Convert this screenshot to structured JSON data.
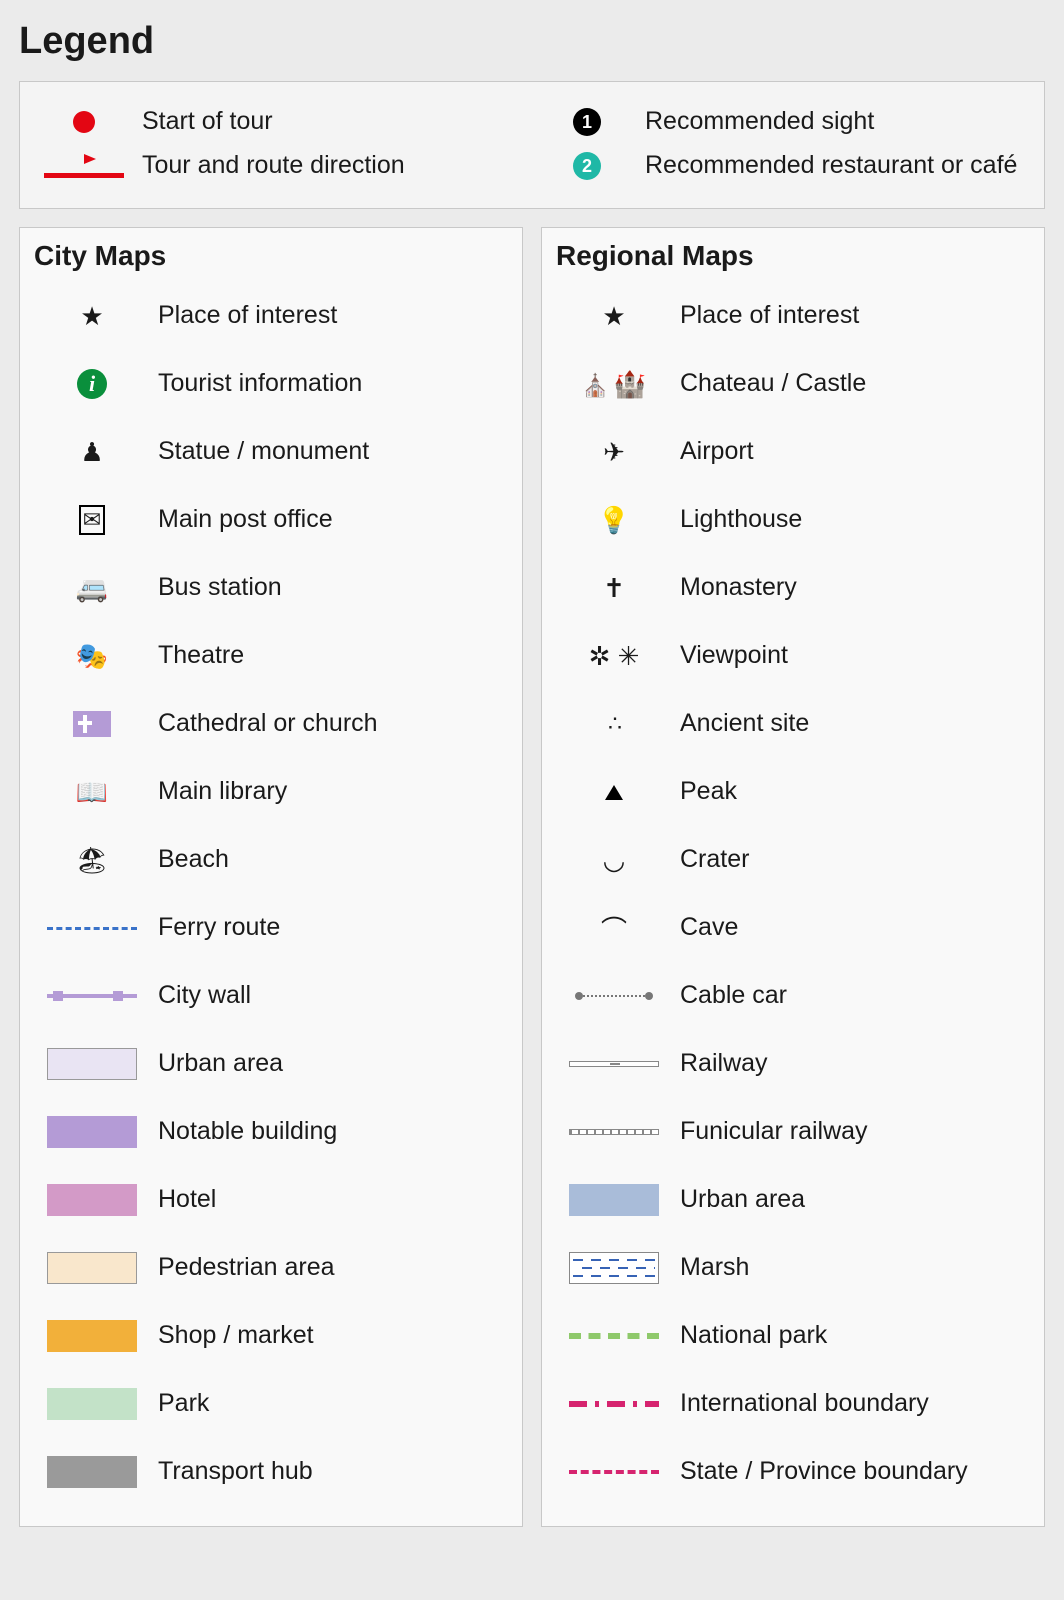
{
  "heading": "Legend",
  "top": {
    "start_of_tour": "Start of tour",
    "tour_route": "Tour and route direction",
    "rec_sight": "Recommended sight",
    "rec_restaurant": "Recommended restaurant or café",
    "num1": "1",
    "num2": "2"
  },
  "city": {
    "title": "City Maps",
    "items": [
      {
        "icon": "star",
        "label": "Place of interest"
      },
      {
        "icon": "info",
        "label": "Tourist information"
      },
      {
        "icon": "statue",
        "label": "Statue / monument"
      },
      {
        "icon": "post",
        "label": "Main post office"
      },
      {
        "icon": "bus",
        "label": "Bus station"
      },
      {
        "icon": "theatre",
        "label": "Theatre"
      },
      {
        "icon": "cathedral",
        "label": "Cathedral or church"
      },
      {
        "icon": "library",
        "label": "Main library"
      },
      {
        "icon": "beach",
        "label": "Beach"
      },
      {
        "icon": "ferry",
        "label": "Ferry route"
      },
      {
        "icon": "citywall",
        "label": "City wall"
      },
      {
        "icon": "urban-city",
        "label": "Urban area",
        "color": "#e9e4f3"
      },
      {
        "icon": "notable",
        "label": "Notable building",
        "color": "#b49bd6"
      },
      {
        "icon": "hotel",
        "label": "Hotel",
        "color": "#d39ac7"
      },
      {
        "icon": "pedestrian",
        "label": "Pedestrian area",
        "color": "#f9e7cc"
      },
      {
        "icon": "shop",
        "label": "Shop / market",
        "color": "#f2b03a"
      },
      {
        "icon": "park",
        "label": "Park",
        "color": "#c3e2c8"
      },
      {
        "icon": "transport",
        "label": "Transport hub",
        "color": "#9a9a9a"
      }
    ]
  },
  "regional": {
    "title": "Regional Maps",
    "items": [
      {
        "icon": "star",
        "label": "Place of interest"
      },
      {
        "icon": "castle",
        "label": "Chateau / Castle"
      },
      {
        "icon": "airport",
        "label": "Airport"
      },
      {
        "icon": "lighthouse",
        "label": "Lighthouse"
      },
      {
        "icon": "monastery",
        "label": "Monastery"
      },
      {
        "icon": "viewpoint",
        "label": "Viewpoint"
      },
      {
        "icon": "ancient",
        "label": "Ancient site"
      },
      {
        "icon": "peak",
        "label": "Peak"
      },
      {
        "icon": "crater",
        "label": "Crater"
      },
      {
        "icon": "cave",
        "label": "Cave"
      },
      {
        "icon": "cablecar",
        "label": "Cable car"
      },
      {
        "icon": "railway",
        "label": "Railway"
      },
      {
        "icon": "funicular",
        "label": "Funicular railway"
      },
      {
        "icon": "urban-reg",
        "label": "Urban area",
        "color": "#a9bcd9"
      },
      {
        "icon": "marsh",
        "label": "Marsh"
      },
      {
        "icon": "natpark",
        "label": "National park"
      },
      {
        "icon": "intl",
        "label": "International boundary"
      },
      {
        "icon": "state",
        "label": "State / Province boundary"
      }
    ]
  }
}
